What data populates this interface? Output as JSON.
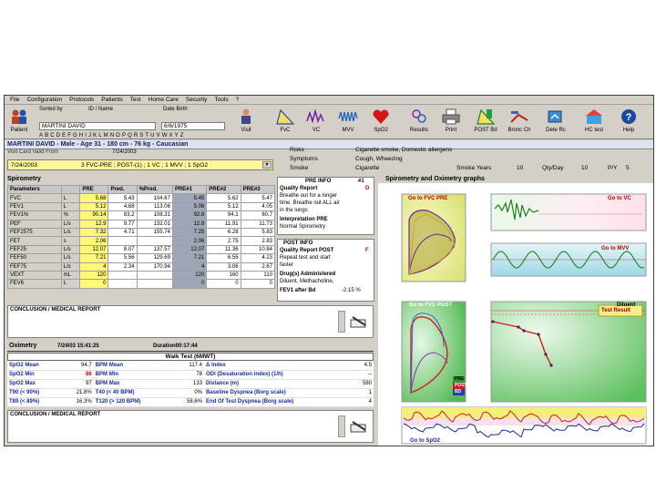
{
  "menu": [
    "File",
    "Configuration",
    "Protocols",
    "Patients",
    "Test",
    "Home Care",
    "Security",
    "Tools",
    "?"
  ],
  "toolbar": {
    "patient": "Patient",
    "visit": "Visit",
    "fvc": "FvC",
    "vc": "VC",
    "mvv": "MVV",
    "spo2": "SpO2",
    "results": "Results",
    "print": "Print",
    "post_bd": "POST Bd",
    "bronch": "Bronc Ch",
    "delete_rec": "Dete Rc",
    "hc_test": "HC test",
    "help": "Help"
  },
  "search": {
    "sort_label": "Sorted by",
    "sort_value": "ID / Name",
    "dob_label": "Date Birth",
    "name_value": "MARTINI DAVID",
    "dob_value": "6/6/1975",
    "alphabet": [
      "A",
      "B",
      "C",
      "D",
      "E",
      "F",
      "G",
      "H",
      "I",
      "J",
      "K",
      "L",
      "M",
      "N",
      "O",
      "P",
      "Q",
      "R",
      "S",
      "T",
      "U",
      "V",
      "W",
      "X",
      "Y",
      "Z"
    ]
  },
  "patient": {
    "summary": "MARTINI DAVID - Male - Age 31 - 180 cm - 76 kg - Caucasian",
    "visit_label": "Visit Card Valid From",
    "visit_date": "7/24/2003",
    "test_date": "7/24/2003",
    "test_desc": "3 FVC-PRE ; POST-(1) ; 1 VC ; 1 MVV ; 1 SpO2",
    "risks_label": "Risks",
    "risks_value": "Cigarette smoke, Domestic allergens",
    "symptoms_label": "Symptoms",
    "symptoms_value": "Cough, Wheezing",
    "smoke_label": "Smoke",
    "smoke_value": "Cigarette",
    "smoke_years_label": "Smoke Years",
    "smoke_years_value": "10",
    "qty_label": "Qty/Day",
    "qty_value": "10",
    "py_label": "P/Y",
    "py_value": "5"
  },
  "spirometry": {
    "title": "Spirometry",
    "headers": [
      "Parameters",
      "",
      "PRE",
      "Pred.",
      "%Pred.",
      "PRE#1",
      "PRE#2",
      "PRE#3"
    ],
    "rows": [
      [
        "FVC",
        "L",
        "5.68",
        "5.43",
        "104.67",
        "5.45",
        "5.62",
        "5.47"
      ],
      [
        "FEV1",
        "L",
        "5.12",
        "4.68",
        "113.06",
        "5.06",
        "5.12",
        "4.05"
      ],
      [
        "FEV1%",
        "%",
        "90.14",
        "83.2",
        "108.31",
        "92.8",
        "94.1",
        "60.7"
      ],
      [
        "PEF",
        "L/s",
        "12.9",
        "9.77",
        "132.01",
        "12.8",
        "11.91",
        "11.73"
      ],
      [
        "FEF2575",
        "L/s",
        "7.32",
        "4.71",
        "155.74",
        "7.25",
        "6.28",
        "5.83"
      ],
      [
        "FET",
        "s",
        "2.06",
        "",
        "",
        "2.06",
        "2.75",
        "2.83"
      ],
      [
        "FEF25",
        "L/s",
        "12.07",
        "8.07",
        "137.57",
        "12.07",
        "11.36",
        "10.84"
      ],
      [
        "FEF50",
        "L/s",
        "7.21",
        "5.56",
        "129.69",
        "7.21",
        "6.55",
        "4.23"
      ],
      [
        "FEF75",
        "L/s",
        "4",
        "2.34",
        "170.94",
        "4",
        "3.06",
        "2.67"
      ],
      [
        "VEXT",
        "mL",
        "120",
        "",
        "",
        "120",
        "160",
        "110"
      ],
      [
        "FEV6",
        "L",
        "0",
        "",
        "",
        "0",
        "0",
        "0"
      ]
    ],
    "conclusion_label": "CONCLUSION / MEDICAL REPORT"
  },
  "pre_info": {
    "title": "PRE INFO",
    "id": "#1",
    "quality_label": "Quality Report",
    "quality_grade": "D",
    "quality_text": [
      "Breathe out for a longer",
      "time. Breathe out ALL air",
      "in the lungs"
    ],
    "interp_label": "Interpretation PRE",
    "interp_value": "Normal Spirometry"
  },
  "post_info": {
    "title": "POST INFO",
    "quality_label": "Quality Report POST",
    "quality_grade": "F",
    "quality_text": [
      "Repeat test and start",
      "faster"
    ],
    "drug_label": "Drug(s) Administered",
    "drug_value": "Diluent, Methacholine,",
    "fev1_label": "FEV1 after Bd",
    "fev1_value": "-2.15 %"
  },
  "oximetry": {
    "title": "Oximetry",
    "datetime": "7/24/03 15:41:25",
    "duration": "Duration00:17:44",
    "walk_label": "Walk Test (6MWT)",
    "rows": [
      [
        "SpO2 Mean",
        "94.7",
        "BPM Mean",
        "117.4",
        "Δ Index",
        "4.5"
      ],
      [
        "SpO2 Min",
        "86",
        "BPM Min",
        "78",
        "ODI (Desaturation index) (1/h)",
        "--"
      ],
      [
        "SpO2 Max",
        "97",
        "BPM Max",
        "133",
        "Distance (m)",
        "580"
      ],
      [
        "T90 (< 90%)",
        "21.8%",
        "T40 (< 40 BPM)",
        "0%",
        "Baseline Dyspnea (Borg scale)",
        "1"
      ],
      [
        "T89 (< 89%)",
        "16.3%",
        "T120 (> 120 BPM)",
        "58.6%",
        "End Of Test Dyspnea (Borg scale)",
        "4"
      ]
    ],
    "conclusion_label": "CONCLUSION / MEDICAL REPORT"
  },
  "graphs": {
    "title": "Spirometry and Oximetry graphs",
    "fvc_pre": "Go to FVC PRE",
    "vc": "Go to VC",
    "mvv": "Go to MVV",
    "fvc_post": "Go to FVC POST",
    "diluent": "Diluent",
    "test_result": "Test Result",
    "spo2": "Go to SpO2",
    "legend": [
      "PRE",
      "POST",
      "BD"
    ]
  },
  "colors": {
    "pre_cell": "#fff77a",
    "best_cell": "#9ea6b8",
    "graph_yellow": "#f4f4a8",
    "graph_green": "#9fd89f",
    "graph_cyan": "#bfe7ef",
    "pink_bg": "#fde8f0",
    "red_curve": "#cc2020",
    "green_curve": "#209a20"
  }
}
